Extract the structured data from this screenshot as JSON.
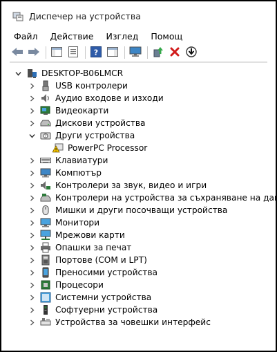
{
  "window": {
    "title": "Диспечер на устройства"
  },
  "menu": [
    "Файл",
    "Действие",
    "Изглед",
    "Помощ"
  ],
  "toolbar": {
    "buttons": [
      {
        "name": "back-button",
        "icon": "arrow-left-icon"
      },
      {
        "name": "forward-button",
        "icon": "arrow-right-icon"
      },
      {
        "name": "show-hide-console-tree-button",
        "icon": "console-tree-icon"
      },
      {
        "name": "properties-button",
        "icon": "properties-icon"
      },
      {
        "name": "help-button",
        "icon": "help-icon"
      },
      {
        "name": "action-pane-button",
        "icon": "action-pane-icon"
      },
      {
        "name": "scan-hardware-button",
        "icon": "monitor-scan-icon"
      },
      {
        "name": "update-driver-button",
        "icon": "update-driver-icon"
      },
      {
        "name": "uninstall-button",
        "icon": "red-x-icon"
      },
      {
        "name": "disable-device-button",
        "icon": "disable-icon"
      }
    ]
  },
  "tree": {
    "root": "DESKTOP-B06LMCR",
    "items": [
      {
        "label": "USB контролери",
        "icon": "usb-icon",
        "expanded": false
      },
      {
        "label": "Аудио входове и изходи",
        "icon": "speaker-icon",
        "expanded": false
      },
      {
        "label": "Видеокарти",
        "icon": "display-adapter-icon",
        "expanded": false
      },
      {
        "label": "Дискови устройства",
        "icon": "disk-drive-icon",
        "expanded": false
      },
      {
        "label": "Други устройства",
        "icon": "other-device-icon",
        "expanded": true,
        "children": [
          {
            "label": "PowerPC Processor",
            "icon": "warning-device-icon"
          }
        ]
      },
      {
        "label": "Клавиатури",
        "icon": "keyboard-icon",
        "expanded": false
      },
      {
        "label": "Компютър",
        "icon": "computer-icon",
        "expanded": false
      },
      {
        "label": "Контролери за звук, видео и игри",
        "icon": "sound-icon",
        "expanded": false
      },
      {
        "label": "Контролери на устройства за съхраняване на данни",
        "icon": "storage-controller-icon",
        "expanded": false
      },
      {
        "label": "Мишки и други посочващи устройства",
        "icon": "mouse-icon",
        "expanded": false
      },
      {
        "label": "Монитори",
        "icon": "monitor-icon",
        "expanded": false
      },
      {
        "label": "Мрежови карти",
        "icon": "network-icon",
        "expanded": false
      },
      {
        "label": "Опашки за печат",
        "icon": "printer-icon",
        "expanded": false
      },
      {
        "label": "Портове (COM и LPT)",
        "icon": "port-icon",
        "expanded": false
      },
      {
        "label": "Преносими устройства",
        "icon": "portable-device-icon",
        "expanded": false
      },
      {
        "label": "Процесори",
        "icon": "processor-icon",
        "expanded": false
      },
      {
        "label": "Системни устройства",
        "icon": "system-device-icon",
        "expanded": false
      },
      {
        "label": "Софтуерни устройства",
        "icon": "software-device-icon",
        "expanded": false
      },
      {
        "label": "Устройства за човешки интерфейс",
        "icon": "hid-icon",
        "expanded": false
      }
    ]
  }
}
